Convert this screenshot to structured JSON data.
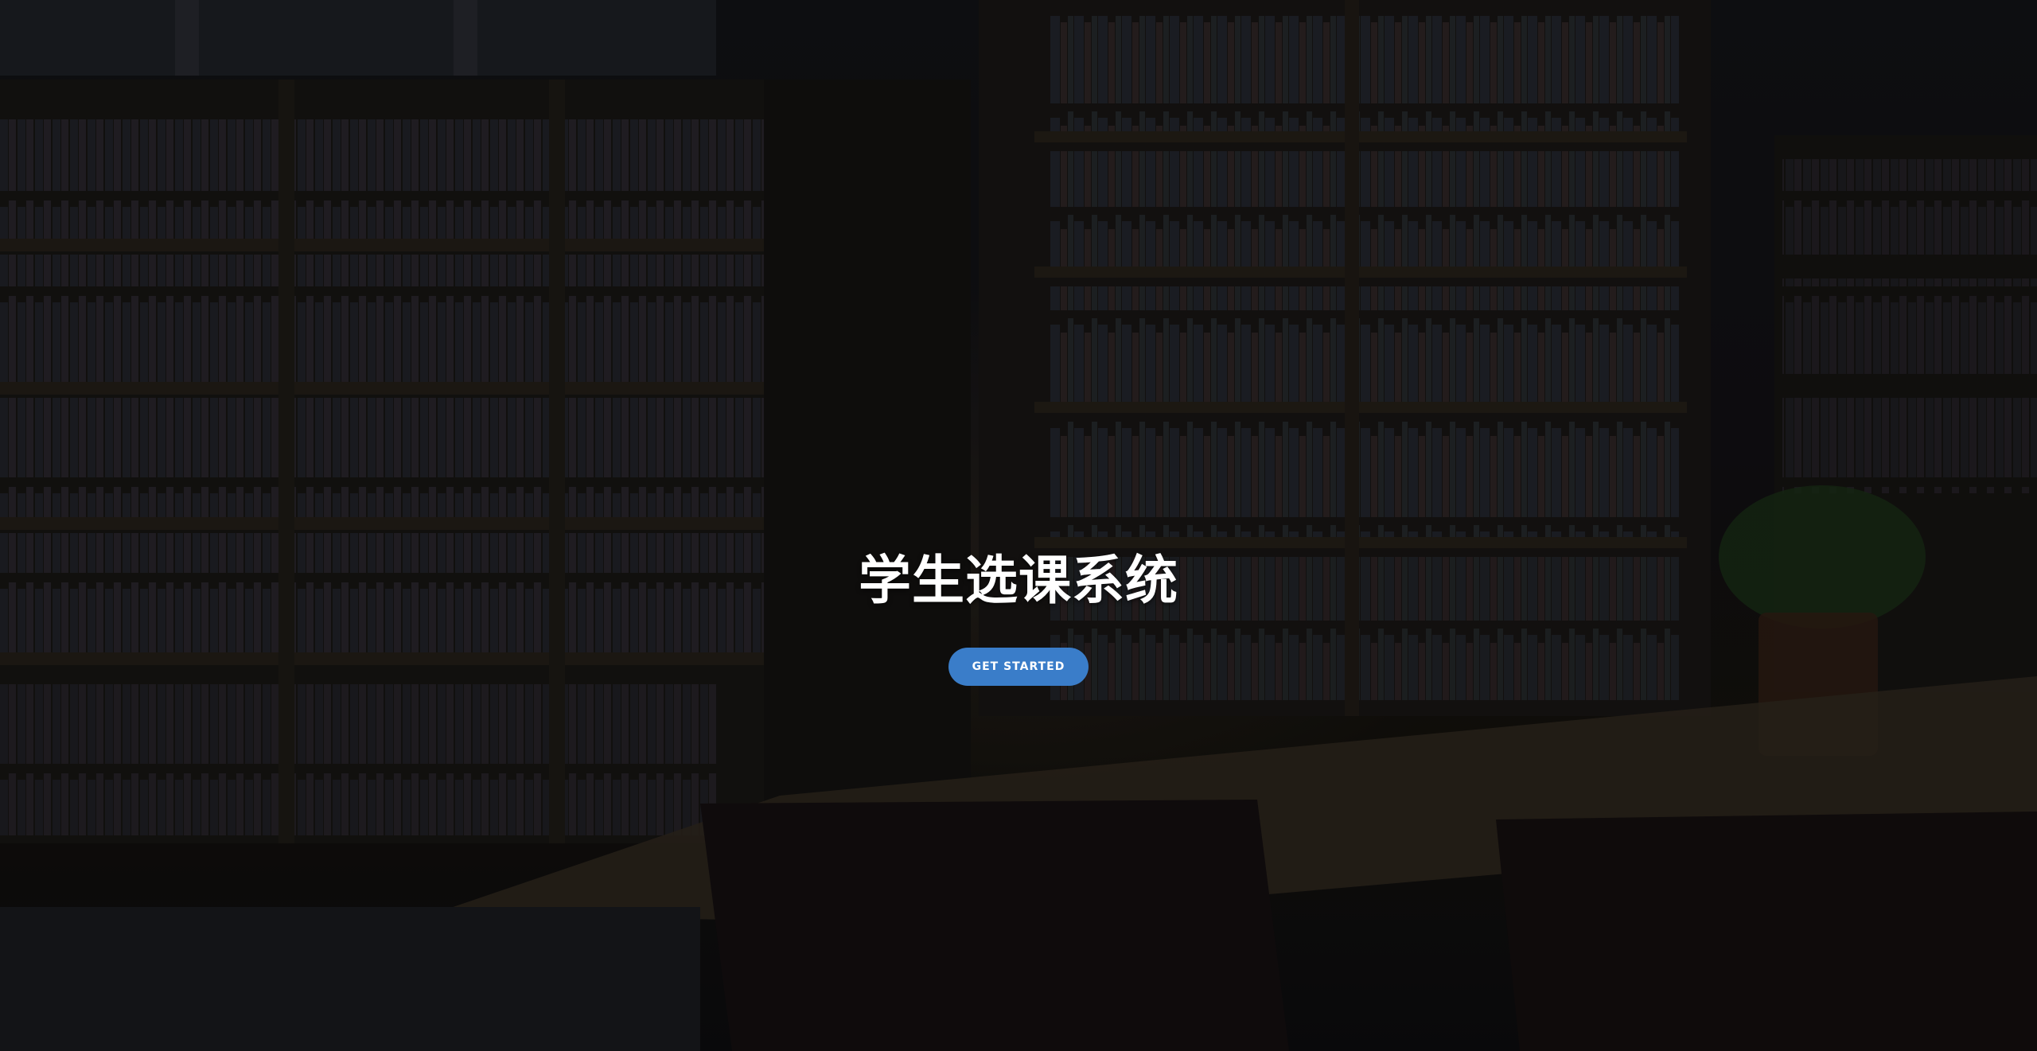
{
  "hero": {
    "title": "学生选课系统",
    "cta_label": "GET STARTED",
    "background_image": "library-icon"
  },
  "colors": {
    "cta_background": "#3a7dc9",
    "title_text": "#ffffff",
    "overlay": "#000000"
  }
}
